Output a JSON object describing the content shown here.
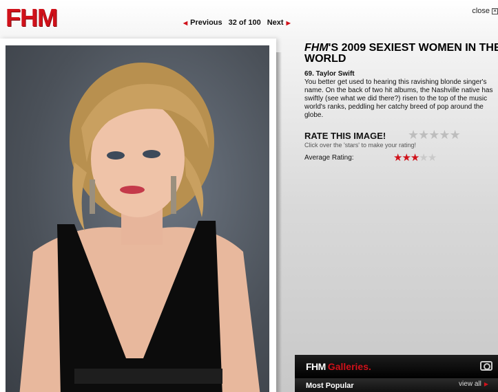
{
  "logo": "FHM",
  "pager": {
    "previous_label": "Previous",
    "count": "32 of 100",
    "next_label": "Next"
  },
  "close_label": "close",
  "article": {
    "title_brand": "FHM",
    "title_rest": "'S 2009 SEXIEST WOMEN IN THE WORLD",
    "entry_name": "69. Taylor Swift",
    "entry_description": "You better get used to hearing this ravishing blonde singer's name. On the back of two hit albums, the Nashville native has swiftly (see what we did there?) risen to the top of the music world's ranks, peddling her catchy breed of pop around the globe."
  },
  "rating": {
    "title": "RATE THIS IMAGE!",
    "hint": "Click over the 'stars' to make your rating!",
    "average_label": "Average Rating:",
    "average_value": 3,
    "max": 5,
    "star_on_color": "#d0111a",
    "star_off_color": "#c9c9c9"
  },
  "galleries": {
    "brand": "FHM",
    "label": "Galleries.",
    "camera_icon": "camera-icon"
  },
  "popular": {
    "label": "Most Popular",
    "view_all": "view all"
  },
  "colors": {
    "brand_red": "#d0111a"
  }
}
